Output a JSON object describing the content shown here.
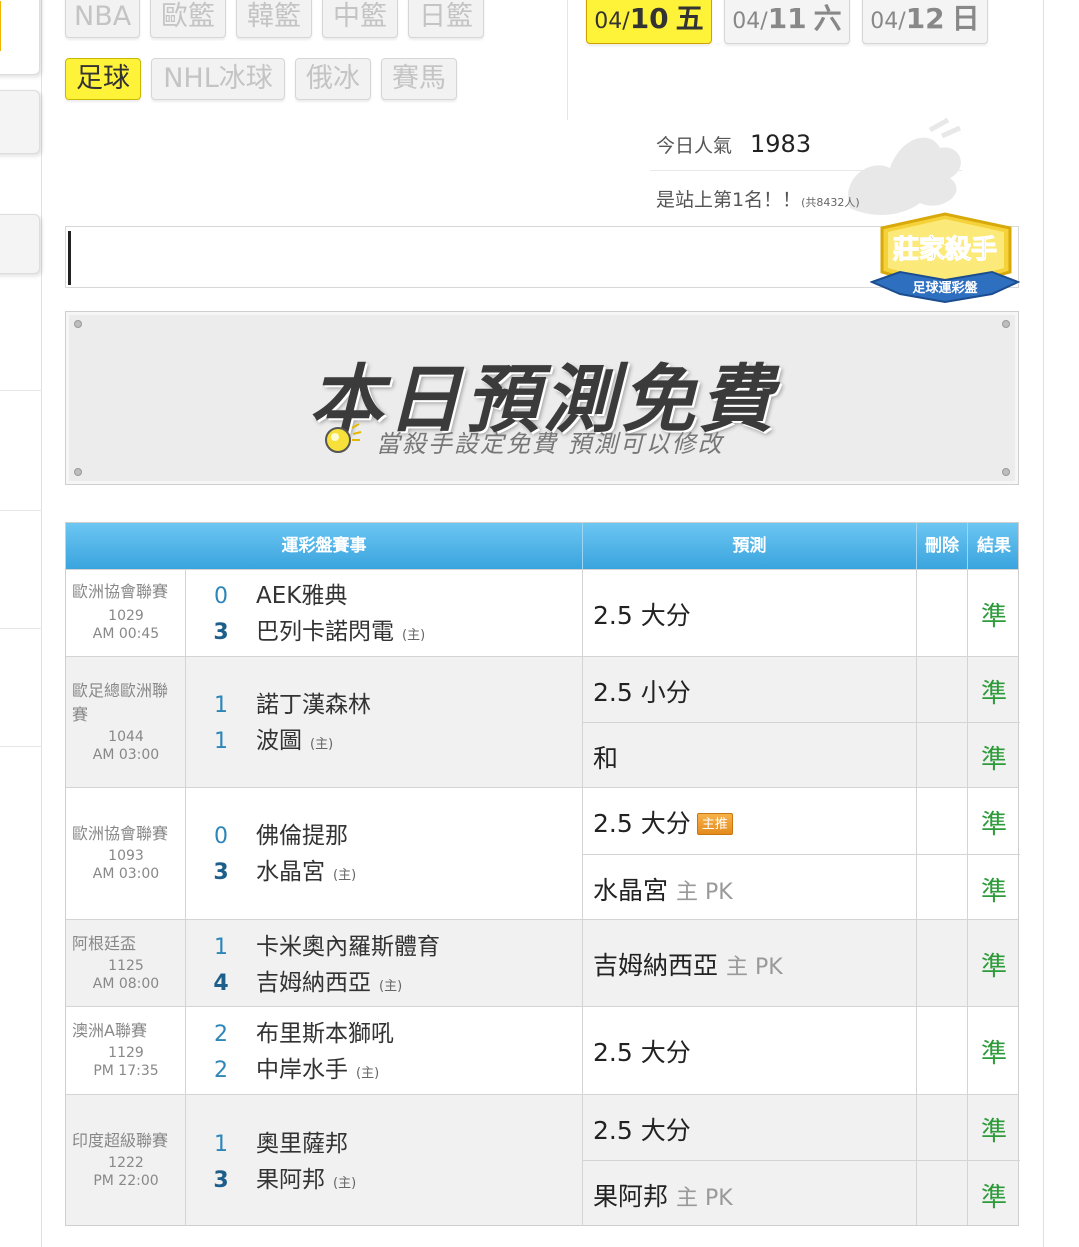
{
  "sport_tabs": [
    {
      "label": "NBA",
      "active": false
    },
    {
      "label": "歐籃",
      "active": false
    },
    {
      "label": "韓籃",
      "active": false
    },
    {
      "label": "中籃",
      "active": false
    },
    {
      "label": "日籃",
      "active": false
    },
    {
      "label": "足球",
      "active": true
    },
    {
      "label": "NHL冰球",
      "active": false
    },
    {
      "label": "俄冰",
      "active": false
    },
    {
      "label": "賽馬",
      "active": false
    }
  ],
  "date_tabs": [
    {
      "mmdd_prefix": "04/",
      "day": "10",
      "weekday": "五",
      "active": true
    },
    {
      "mmdd_prefix": "04/",
      "day": "11",
      "weekday": "六",
      "active": false
    },
    {
      "mmdd_prefix": "04/",
      "day": "12",
      "weekday": "日",
      "active": false
    }
  ],
  "popularity": {
    "label": "今日人氣",
    "count": "1983",
    "rank_text": "是站上第1名！！",
    "total_text": "(共8432人)"
  },
  "badge": {
    "title": "莊家殺手",
    "subtitle": "足球運彩盤"
  },
  "banner": {
    "title": "本日預測免費",
    "subtitle": "當殺手設定免費  預測可以修改"
  },
  "table": {
    "headers": {
      "match": "運彩盤賽事",
      "prediction": "預測",
      "delete": "刪除",
      "result": "結果"
    },
    "home_marker": "(主)",
    "rows": [
      {
        "league": "歐洲協會聯賽",
        "game_id": "1029",
        "time": "AM 00:45",
        "away": {
          "score": "0",
          "team": "AEK雅典"
        },
        "home": {
          "score": "3",
          "team": "巴列卡諾閃電"
        },
        "predictions": [
          {
            "pick": "2.5 大分",
            "extra": "",
            "tag": "",
            "result": "準"
          }
        ]
      },
      {
        "league": "歐足總歐洲聯賽",
        "game_id": "1044",
        "time": "AM 03:00",
        "away": {
          "score": "1",
          "team": "諾丁漢森林"
        },
        "home": {
          "score": "1",
          "team": "波圖"
        },
        "predictions": [
          {
            "pick": "2.5 小分",
            "extra": "",
            "tag": "",
            "result": "準"
          },
          {
            "pick": "和",
            "extra": "",
            "tag": "",
            "result": "準"
          }
        ]
      },
      {
        "league": "歐洲協會聯賽",
        "game_id": "1093",
        "time": "AM 03:00",
        "away": {
          "score": "0",
          "team": "佛倫提那"
        },
        "home": {
          "score": "3",
          "team": "水晶宮"
        },
        "predictions": [
          {
            "pick": "2.5 大分",
            "extra": "",
            "tag": "主推",
            "result": "準"
          },
          {
            "pick": "水晶宮",
            "extra": "主 PK",
            "tag": "",
            "result": "準"
          }
        ]
      },
      {
        "league": "阿根廷盃",
        "game_id": "1125",
        "time": "AM 08:00",
        "away": {
          "score": "1",
          "team": "卡米奧內羅斯體育"
        },
        "home": {
          "score": "4",
          "team": "吉姆納西亞"
        },
        "predictions": [
          {
            "pick": "吉姆納西亞",
            "extra": "主 PK",
            "tag": "",
            "result": "準"
          }
        ]
      },
      {
        "league": "澳洲A聯賽",
        "game_id": "1129",
        "time": "PM 17:35",
        "away": {
          "score": "2",
          "team": "布里斯本獅吼"
        },
        "home": {
          "score": "2",
          "team": "中岸水手"
        },
        "predictions": [
          {
            "pick": "2.5 大分",
            "extra": "",
            "tag": "",
            "result": "準"
          }
        ]
      },
      {
        "league": "印度超級聯賽",
        "game_id": "1222",
        "time": "PM 22:00",
        "away": {
          "score": "1",
          "team": "奧里薩邦"
        },
        "home": {
          "score": "3",
          "team": "果阿邦"
        },
        "predictions": [
          {
            "pick": "2.5 大分",
            "extra": "",
            "tag": "",
            "result": "準"
          },
          {
            "pick": "果阿邦",
            "extra": "主 PK",
            "tag": "",
            "result": "準"
          }
        ]
      }
    ]
  },
  "colors": {
    "active_tab": "#fff33a",
    "header_blue": "#3aa4de",
    "result_green": "#2e9b3a",
    "score_blue": "#2d86b8",
    "tag_orange": "#e48a1c"
  }
}
